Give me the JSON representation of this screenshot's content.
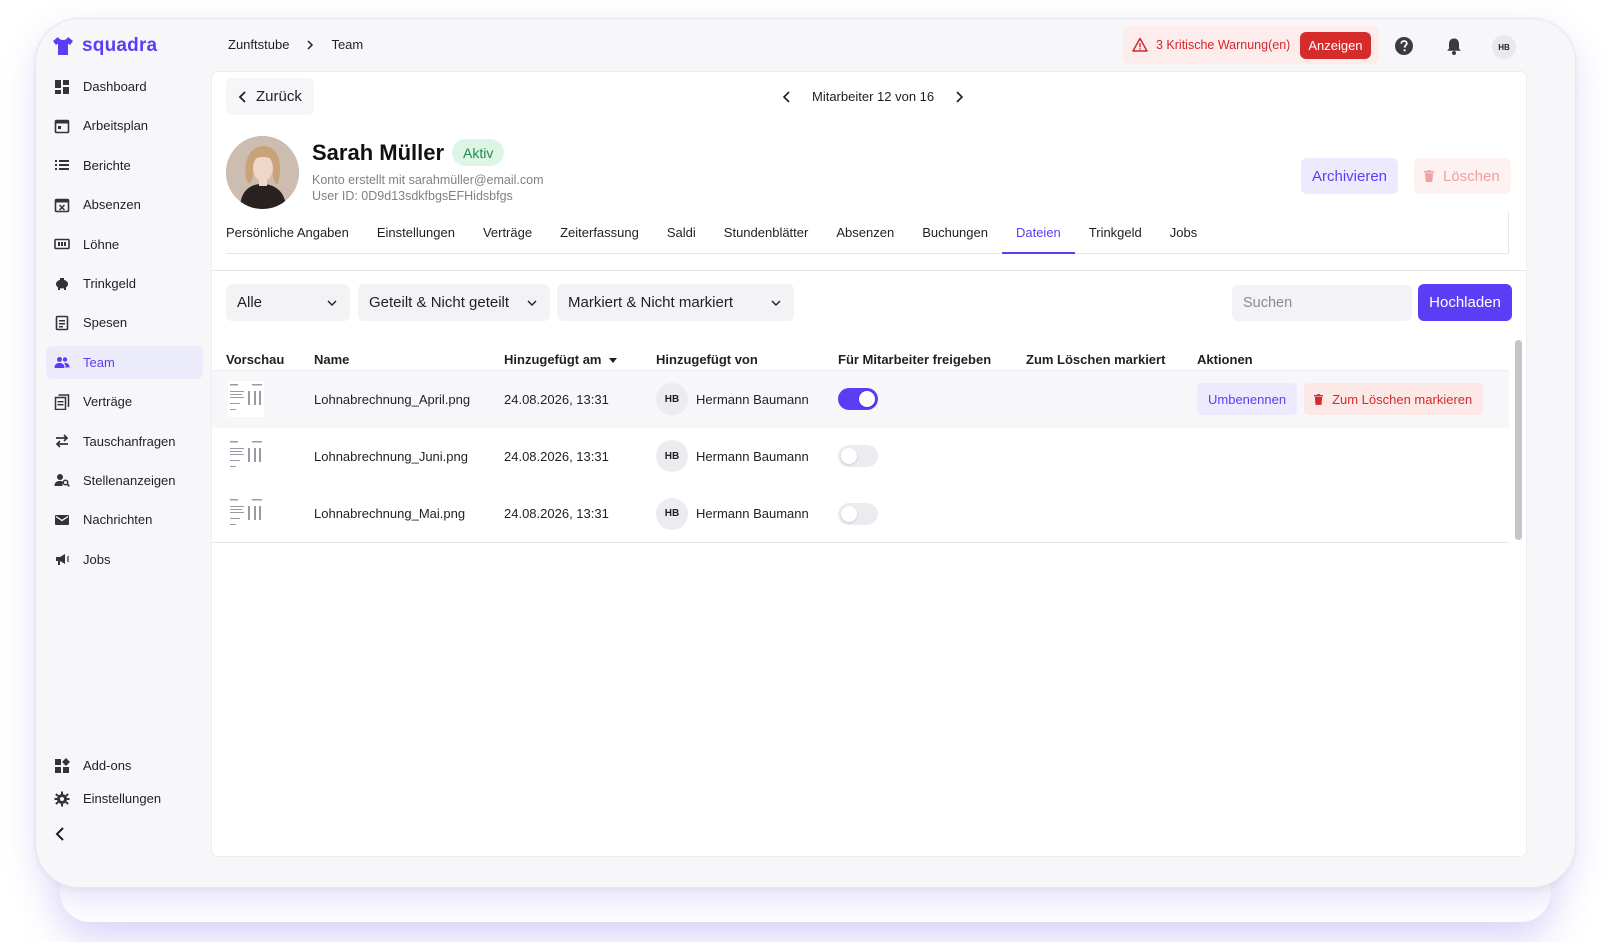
{
  "app": {
    "name": "squadra",
    "brand_color": "#5b3df5"
  },
  "sidebar": {
    "items": [
      {
        "label": "Dashboard",
        "icon": "dashboard-icon"
      },
      {
        "label": "Arbeitsplan",
        "icon": "calendar-icon"
      },
      {
        "label": "Berichte",
        "icon": "list-icon"
      },
      {
        "label": "Absenzen",
        "icon": "calendar-x-icon"
      },
      {
        "label": "Löhne",
        "icon": "money-icon"
      },
      {
        "label": "Trinkgeld",
        "icon": "piggy-bank-icon"
      },
      {
        "label": "Spesen",
        "icon": "receipt-icon"
      },
      {
        "label": "Team",
        "icon": "team-icon",
        "active": true
      },
      {
        "label": "Verträge",
        "icon": "contract-icon"
      },
      {
        "label": "Tauschanfragen",
        "icon": "swap-icon"
      },
      {
        "label": "Stellenanzeigen",
        "icon": "person-search-icon"
      },
      {
        "label": "Nachrichten",
        "icon": "mail-icon"
      },
      {
        "label": "Jobs",
        "icon": "megaphone-icon"
      }
    ],
    "bottom_items": [
      {
        "label": "Add-ons",
        "icon": "add-ons-icon"
      },
      {
        "label": "Einstellungen",
        "icon": "gear-icon"
      }
    ]
  },
  "topbar": {
    "breadcrumb": [
      "Zunftstube",
      "Team"
    ],
    "warning": {
      "text": "3 Kritische Warnung(en)",
      "action": "Anzeigen"
    },
    "user_initials": "HB"
  },
  "nav": {
    "back_label": "Zurück",
    "pager": "Mitarbeiter 12 von 16"
  },
  "profile": {
    "name": "Sarah Müller",
    "status": "Aktiv",
    "account_line": "Konto erstellt mit sarahmüller@email.com",
    "user_id_line": "User ID: 0D9d13sdkfbgsEFHidsbfgs",
    "archive_label": "Archivieren",
    "delete_label": "Löschen"
  },
  "tabs": [
    {
      "label": "Persönliche Angaben"
    },
    {
      "label": "Einstellungen"
    },
    {
      "label": "Verträge"
    },
    {
      "label": "Zeiterfassung"
    },
    {
      "label": "Saldi"
    },
    {
      "label": "Stundenblätter"
    },
    {
      "label": "Absenzen"
    },
    {
      "label": "Buchungen"
    },
    {
      "label": "Dateien",
      "active": true
    },
    {
      "label": "Trinkgeld"
    },
    {
      "label": "Jobs"
    }
  ],
  "filters": {
    "type": "Alle",
    "shared": "Geteilt & Nicht geteilt",
    "marked": "Markiert & Nicht markiert",
    "search_placeholder": "Suchen",
    "upload_label": "Hochladen"
  },
  "table": {
    "columns": {
      "preview": "Vorschau",
      "name": "Name",
      "added_on": "Hinzugefügt am",
      "added_by": "Hinzugefügt von",
      "share": "Für Mitarbeiter freigeben",
      "marked_delete": "Zum Löschen markiert",
      "actions": "Aktionen"
    },
    "rows": [
      {
        "name": "Lohnabrechnung_April.png",
        "date": "24.08.2026, 13:31",
        "by_initials": "HB",
        "by": "Hermann Baumann",
        "shared": true
      },
      {
        "name": "Lohnabrechnung_Juni.png",
        "date": "24.08.2026, 13:31",
        "by_initials": "HB",
        "by": "Hermann Baumann",
        "shared": false
      },
      {
        "name": "Lohnabrechnung_Mai.png",
        "date": "24.08.2026, 13:31",
        "by_initials": "HB",
        "by": "Hermann Baumann",
        "shared": false
      }
    ],
    "row_actions": {
      "rename": "Umbenennen",
      "mark_delete": "Zum Löschen markieren"
    }
  }
}
